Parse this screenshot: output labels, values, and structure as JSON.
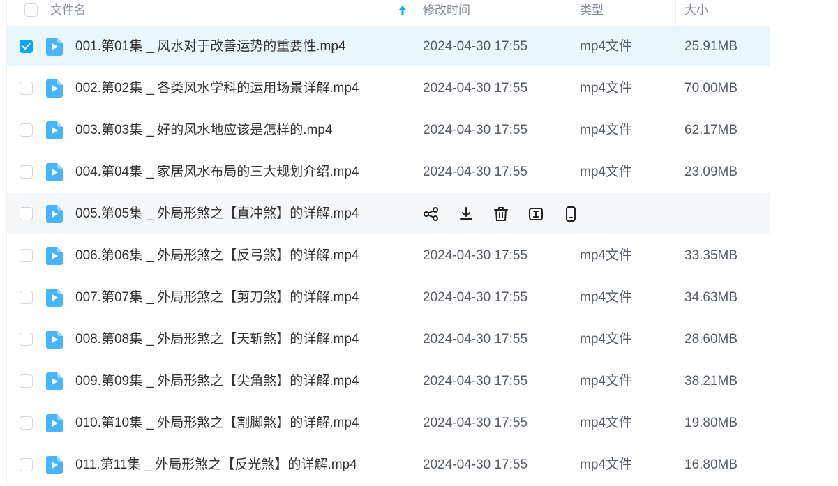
{
  "header": {
    "filename_label": "文件名",
    "modified_label": "修改时间",
    "type_label": "类型",
    "size_label": "大小",
    "sort_icon": "sort-up-arrow-icon"
  },
  "colors": {
    "accent": "#06a7ff",
    "selected_row": "#eaf6fd",
    "hover_row": "#f6f7f9",
    "header_text": "#878c9c"
  },
  "row_actions": [
    "share-icon",
    "download-icon",
    "delete-icon",
    "rename-icon",
    "mobile-icon"
  ],
  "files": [
    {
      "name": "001.第01集 _ 风水对于改善运势的重要性.mp4",
      "modified": "2024-04-30 17:55",
      "type": "mp4文件",
      "size": "25.91MB",
      "checked": true
    },
    {
      "name": "002.第02集 _ 各类风水学科的运用场景详解.mp4",
      "modified": "2024-04-30 17:55",
      "type": "mp4文件",
      "size": "70.00MB",
      "checked": false
    },
    {
      "name": "003.第03集 _ 好的风水地应该是怎样的.mp4",
      "modified": "2024-04-30 17:55",
      "type": "mp4文件",
      "size": "62.17MB",
      "checked": false
    },
    {
      "name": "004.第04集 _ 家居风水布局的三大规划介绍.mp4",
      "modified": "2024-04-30 17:55",
      "type": "mp4文件",
      "size": "23.09MB",
      "checked": false
    },
    {
      "name": "005.第05集 _ 外局形煞之【直冲煞】的详解.mp4",
      "modified": "",
      "type": "",
      "size": "",
      "checked": false,
      "hovered": true
    },
    {
      "name": "006.第06集 _ 外局形煞之【反弓煞】的详解.mp4",
      "modified": "2024-04-30 17:55",
      "type": "mp4文件",
      "size": "33.35MB",
      "checked": false
    },
    {
      "name": "007.第07集 _ 外局形煞之【剪刀煞】的详解.mp4",
      "modified": "2024-04-30 17:55",
      "type": "mp4文件",
      "size": "34.63MB",
      "checked": false
    },
    {
      "name": "008.第08集 _ 外局形煞之【天斩煞】的详解.mp4",
      "modified": "2024-04-30 17:55",
      "type": "mp4文件",
      "size": "28.60MB",
      "checked": false
    },
    {
      "name": "009.第09集 _ 外局形煞之【尖角煞】的详解.mp4",
      "modified": "2024-04-30 17:55",
      "type": "mp4文件",
      "size": "38.21MB",
      "checked": false
    },
    {
      "name": "010.第10集 _ 外局形煞之【割脚煞】的详解.mp4",
      "modified": "2024-04-30 17:55",
      "type": "mp4文件",
      "size": "19.80MB",
      "checked": false
    },
    {
      "name": "011.第11集 _ 外局形煞之【反光煞】的详解.mp4",
      "modified": "2024-04-30 17:55",
      "type": "mp4文件",
      "size": "16.80MB",
      "checked": false
    }
  ]
}
